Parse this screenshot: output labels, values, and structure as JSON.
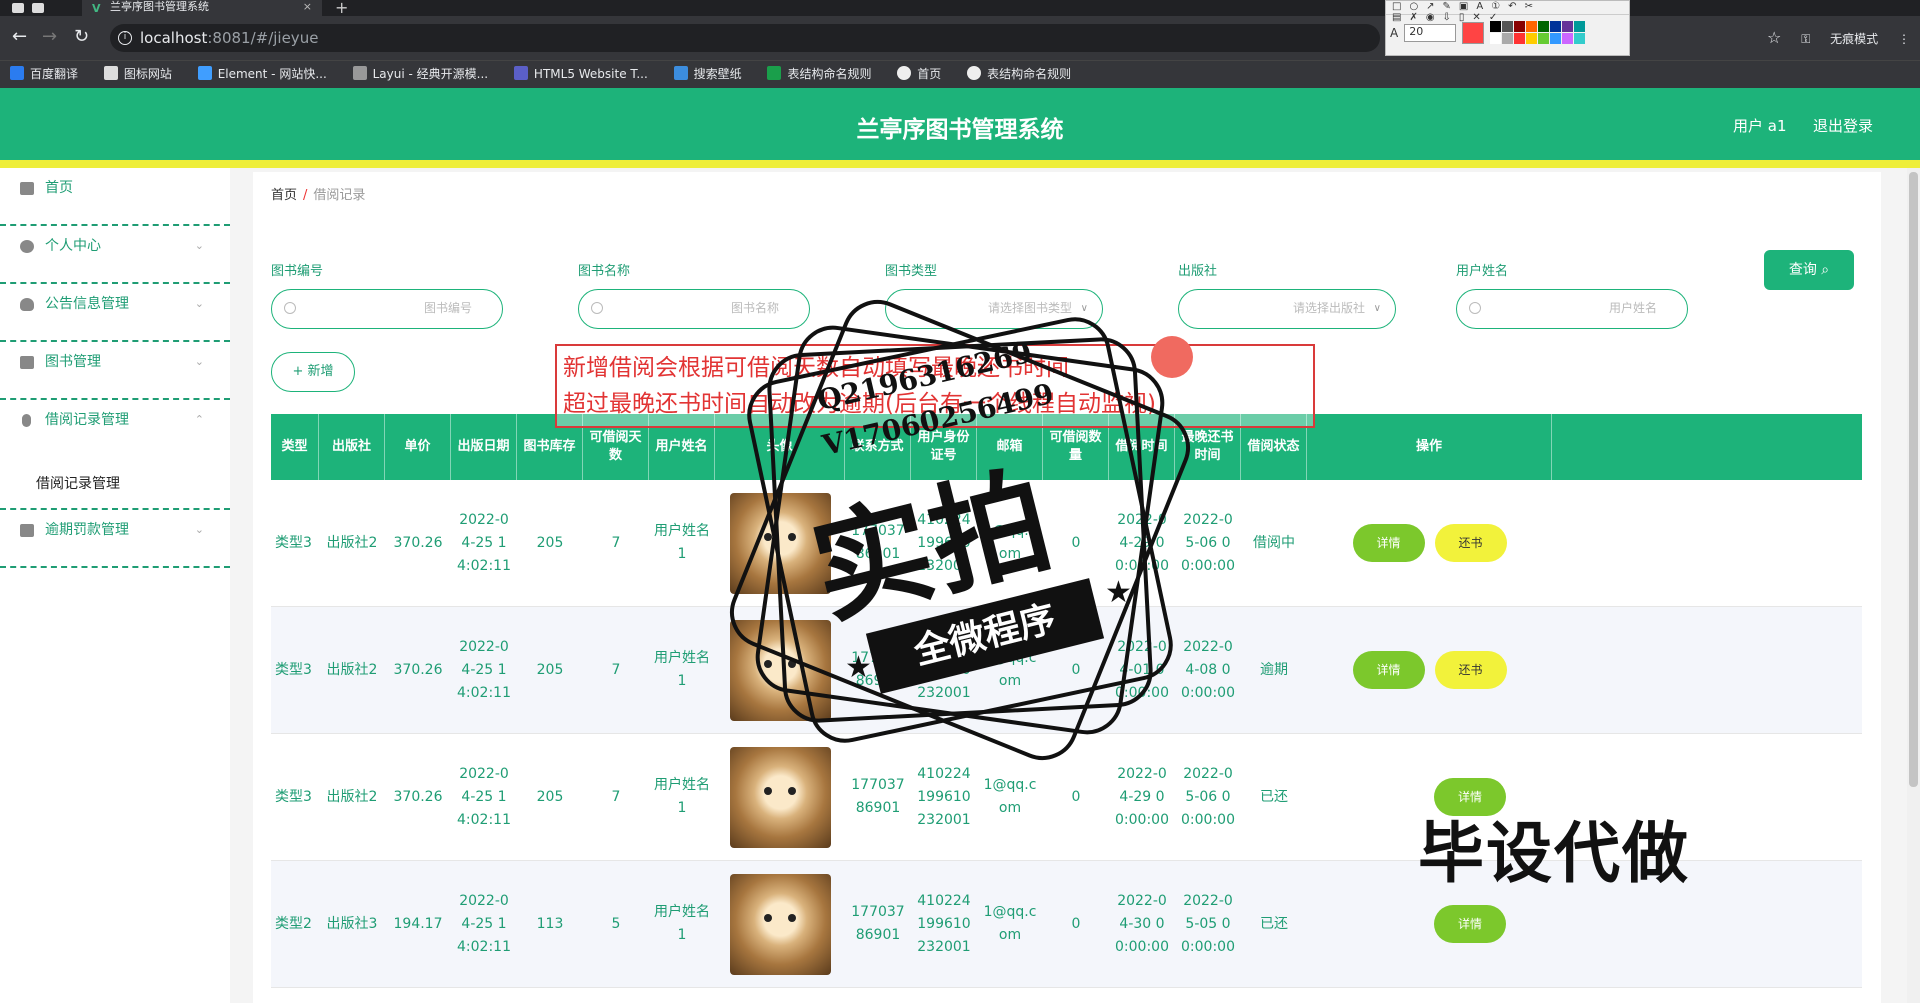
{
  "browser": {
    "tab_title": "兰亭序图书管理系统",
    "url_host": "localhost",
    "url_path": ":8081/#/jieyue",
    "incognito_label": "无痕模式",
    "bookmarks": [
      "百度翻译",
      "图标网站",
      "Element - 网站快...",
      "Layui - 经典开源模...",
      "HTML5 Website T...",
      "搜索壁纸",
      "表结构命名规则",
      "首页",
      "表结构命名规则"
    ],
    "palette_font_size": "20"
  },
  "header": {
    "title": "兰亭序图书管理系统",
    "user_label": "用户 a1",
    "logout_label": "退出登录"
  },
  "sidebar": {
    "items": [
      {
        "label": "首页",
        "icon": "home-icon"
      },
      {
        "label": "个人中心",
        "icon": "user-icon",
        "arrow": "⌄"
      },
      {
        "label": "公告信息管理",
        "icon": "bulb-icon",
        "arrow": "⌄"
      },
      {
        "label": "图书管理",
        "icon": "grid-icon",
        "arrow": "⌄"
      },
      {
        "label": "借阅记录管理",
        "icon": "mic-icon",
        "arrow": "⌃"
      },
      {
        "label": "逾期罚款管理",
        "icon": "stack-icon",
        "arrow": "⌄"
      }
    ],
    "sub_item": "借阅记录管理"
  },
  "breadcrumb": {
    "home": "首页",
    "sep": "/",
    "current": "借阅记录"
  },
  "filters": {
    "book_no": {
      "label": "图书编号",
      "placeholder": "图书编号"
    },
    "book_name": {
      "label": "图书名称",
      "placeholder": "图书名称"
    },
    "book_type": {
      "label": "图书类型",
      "placeholder": "请选择图书类型"
    },
    "publisher": {
      "label": "出版社",
      "placeholder": "请选择出版社"
    },
    "user_name": {
      "label": "用户姓名",
      "placeholder": "用户姓名"
    },
    "query_label": "查询",
    "add_label": "+ 新增"
  },
  "table": {
    "headers": [
      "类型",
      "出版社",
      "单价",
      "出版日期",
      "图书库存",
      "可借阅天数",
      "用户姓名",
      "头像",
      "联系方式",
      "用户身份证号",
      "邮箱",
      "可借阅数量",
      "借阅时间",
      "最晚还书时间",
      "借阅状态",
      "操作"
    ],
    "rows": [
      {
        "type": "类型3",
        "publisher": "出版社2",
        "price": "370.26",
        "pub_date": "2022-04-25 14:02:11",
        "stock": "205",
        "days": "7",
        "user": "用户姓名1",
        "phone": "17703786901",
        "idcard": "410224199610232001",
        "email": "1@qq.com",
        "count": "0",
        "borrow_time": "2022-04-29 00:00:00",
        "due_time": "2022-05-06 00:00:00",
        "status": "借阅中",
        "actions": [
          "详情",
          "还书"
        ]
      },
      {
        "type": "类型3",
        "publisher": "出版社2",
        "price": "370.26",
        "pub_date": "2022-04-25 14:02:11",
        "stock": "205",
        "days": "7",
        "user": "用户姓名1",
        "phone": "17703786901",
        "idcard": "410224199610232001",
        "email": "1@qq.com",
        "count": "0",
        "borrow_time": "2022-04-01 00:00:00",
        "due_time": "2022-04-08 00:00:00",
        "status": "逾期",
        "actions": [
          "详情",
          "还书"
        ]
      },
      {
        "type": "类型3",
        "publisher": "出版社2",
        "price": "370.26",
        "pub_date": "2022-04-25 14:02:11",
        "stock": "205",
        "days": "7",
        "user": "用户姓名1",
        "phone": "17703786901",
        "idcard": "410224199610232001",
        "email": "1@qq.com",
        "count": "0",
        "borrow_time": "2022-04-29 00:00:00",
        "due_time": "2022-05-06 00:00:00",
        "status": "已还",
        "actions": [
          "详情"
        ]
      },
      {
        "type": "类型2",
        "publisher": "出版社3",
        "price": "194.17",
        "pub_date": "2022-04-25 14:02:11",
        "stock": "113",
        "days": "5",
        "user": "用户姓名1",
        "phone": "17703786901",
        "idcard": "410224199610232001",
        "email": "1@qq.com",
        "count": "0",
        "borrow_time": "2022-04-30 00:00:00",
        "due_time": "2022-05-05 00:00:00",
        "status": "已还",
        "actions": [
          "详情"
        ]
      }
    ]
  },
  "annotation": {
    "line1": "新增借阅会根据可借阅天数自动填写最晚还书时间",
    "line2": "超过最晚还书时间自动改为逾期(后台有一个线程自动监视)"
  },
  "watermark": {
    "qq": "Q2196316269",
    "v": "V17060256499",
    "big": "实拍",
    "ribbon": "全微程序",
    "corner": "毕设代做"
  },
  "colors": {
    "primary": "#1db37a",
    "accent_yellow": "#eeee3a",
    "detail_btn": "#7cc82c",
    "return_btn": "#f2f23b"
  }
}
